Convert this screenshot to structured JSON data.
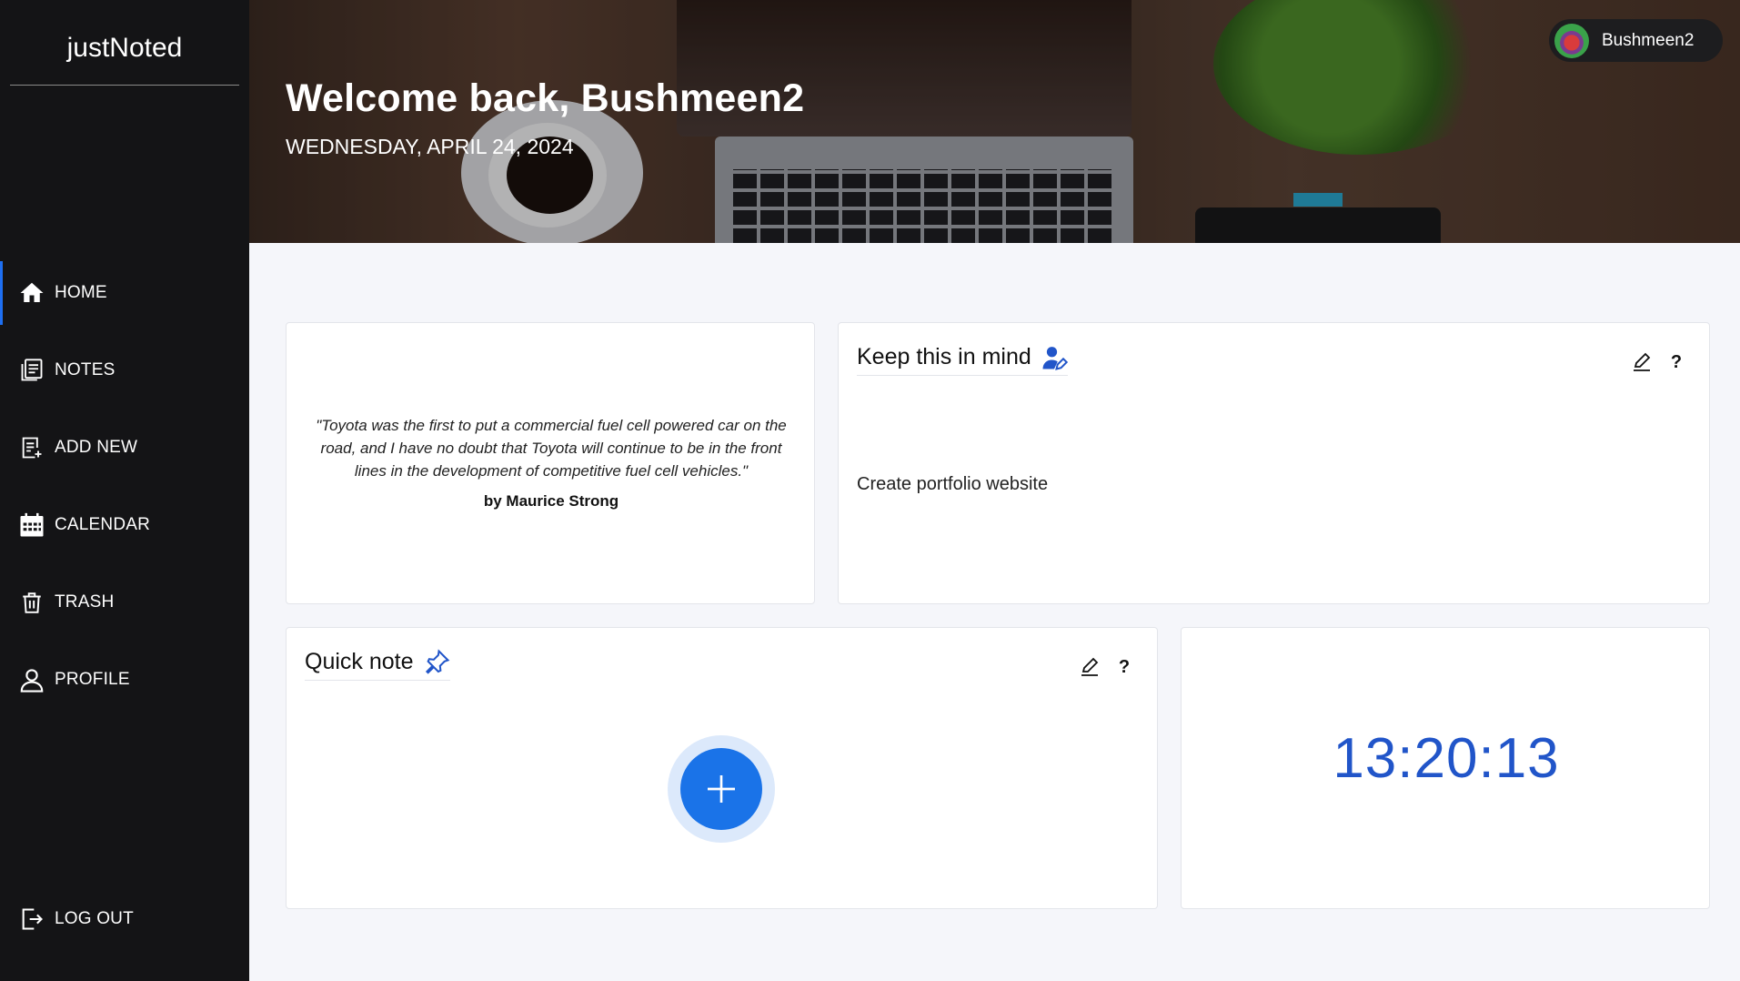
{
  "app": {
    "brand": "justNoted"
  },
  "sidebar": {
    "items": [
      {
        "label": "HOME",
        "icon": "home-icon",
        "active": true
      },
      {
        "label": "NOTES",
        "icon": "notes-icon"
      },
      {
        "label": "ADD NEW",
        "icon": "add-note-icon"
      },
      {
        "label": "CALENDAR",
        "icon": "calendar-icon"
      },
      {
        "label": "TRASH",
        "icon": "trash-icon"
      },
      {
        "label": "PROFILE",
        "icon": "user-icon"
      }
    ],
    "logout": {
      "label": "LOG OUT",
      "icon": "logout-icon"
    }
  },
  "header": {
    "welcome": "Welcome back, Bushmeen2",
    "date": "WEDNESDAY, APRIL 24, 2024"
  },
  "user": {
    "name": "Bushmeen2"
  },
  "quote": {
    "text": "\"Toyota was the first to put a commercial fuel cell powered car on the road, and I have no doubt that Toyota will continue to be in the front lines in the development of competitive fuel cell vehicles.\"",
    "author": "by Maurice Strong"
  },
  "keep_in_mind": {
    "title": "Keep this in mind",
    "text": "Create portfolio website",
    "help": "?"
  },
  "quick_note": {
    "title": "Quick note",
    "help": "?"
  },
  "clock": {
    "time": "13:20:13"
  },
  "colors": {
    "accent": "#1a73e8",
    "clock": "#2155c9",
    "sidebar": "#141416"
  }
}
